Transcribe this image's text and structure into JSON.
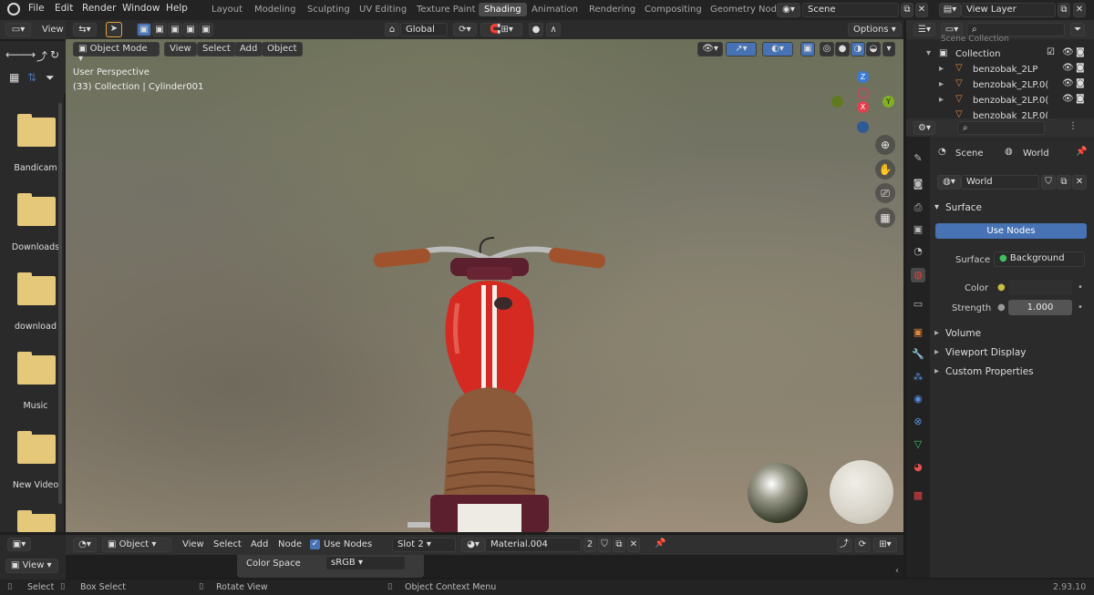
{
  "menu": [
    "File",
    "Edit",
    "Render",
    "Window",
    "Help"
  ],
  "workspaces": [
    "Layout",
    "Modeling",
    "Sculpting",
    "UV Editing",
    "Texture Paint",
    "Shading",
    "Animation",
    "Rendering",
    "Compositing",
    "Geometry Nod"
  ],
  "scene": "Scene",
  "view_layer": "View Layer",
  "filebrowser": {
    "view": "View",
    "folders": [
      "Bandicam",
      "Downloads",
      "download",
      "Music",
      "New Video"
    ]
  },
  "viewport": {
    "mode": "Object Mode",
    "menus": [
      "View",
      "Select",
      "Add",
      "Object"
    ],
    "transform": "Global",
    "options": "Options",
    "info_line1": "User Perspective",
    "info_line2": "(33) Collection | Cylinder001",
    "gizmo": {
      "z": "Z",
      "y": "Y",
      "x": "X"
    }
  },
  "outliner": {
    "top": "Scene Collection",
    "collection": "Collection",
    "items": [
      "benzobak_2LP",
      "benzobak_2LP.0(",
      "benzobak_2LP.0(",
      "benzobak_2LP.0("
    ]
  },
  "properties": {
    "scene": "Scene",
    "world": "World",
    "world_field": "World",
    "surface": "Surface",
    "use_nodes": "Use Nodes",
    "surface_label": "Surface",
    "surface_value": "Background",
    "color_label": "Color",
    "strength_label": "Strength",
    "strength_value": "1.000",
    "sections": [
      "Volume",
      "Viewport Display",
      "Custom Properties"
    ]
  },
  "node_editor": {
    "object": "Object",
    "menus": [
      "View",
      "Select",
      "Add",
      "Node"
    ],
    "use_nodes": "Use Nodes",
    "slot": "Slot 2",
    "material": "Material.004",
    "users": "2",
    "color_space_label": "Color Space",
    "color_space": "sRGB"
  },
  "status": {
    "select": "Select",
    "box_select": "Box Select",
    "rotate_view": "Rotate View",
    "context_menu": "Object Context Menu",
    "version": "2.93.10"
  },
  "colors": {
    "accent": "#4772b3",
    "bike_red": "#d42a22",
    "seat_brown": "#8b5a3a"
  }
}
